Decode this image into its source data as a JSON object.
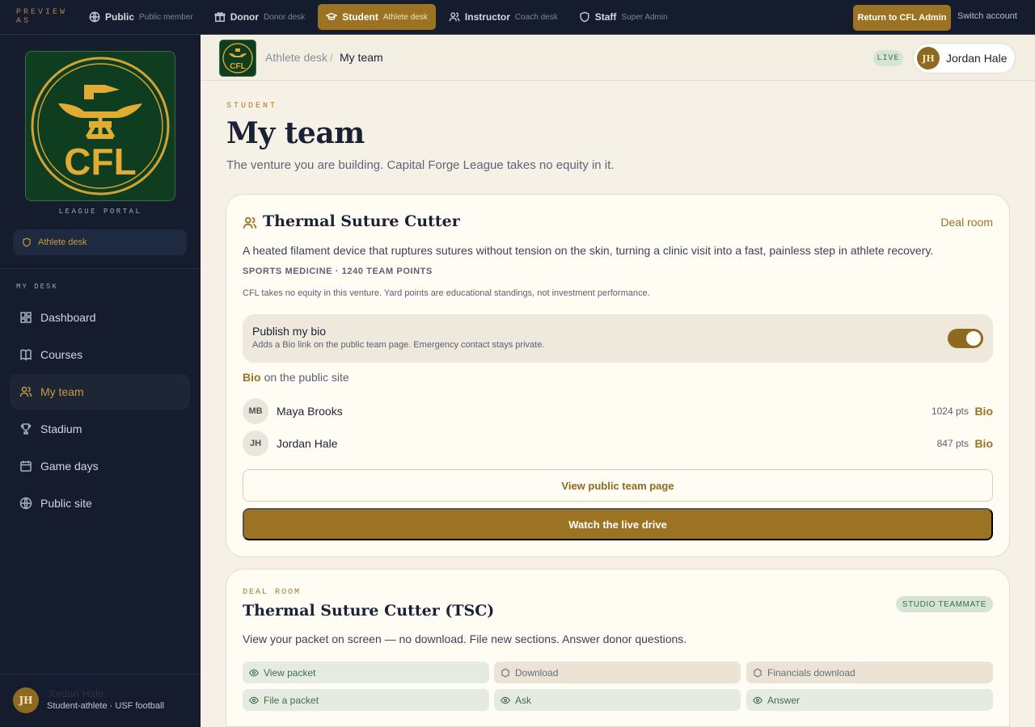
{
  "preview_bar": {
    "label": "PREVIEW AS",
    "roles": [
      {
        "name": "Public",
        "sub": "Public member",
        "icon": "globe-icon",
        "active": false
      },
      {
        "name": "Donor",
        "sub": "Donor desk",
        "icon": "gift-icon",
        "active": false
      },
      {
        "name": "Student",
        "sub": "Athlete desk",
        "icon": "graduation-cap-icon",
        "active": true
      },
      {
        "name": "Instructor",
        "sub": "Coach desk",
        "icon": "users-icon",
        "active": false
      },
      {
        "name": "Staff",
        "sub": "Super Admin",
        "icon": "shield-icon",
        "active": false
      }
    ],
    "return_label": "Return to CFL Admin",
    "switch_label": "Switch account"
  },
  "sidebar": {
    "logo_text": "CFL",
    "portal_label": "LEAGUE PORTAL",
    "desk_pill": "Athlete desk",
    "section_label": "MY DESK",
    "items": [
      {
        "label": "Dashboard",
        "icon": "dashboard-icon",
        "active": false
      },
      {
        "label": "Courses",
        "icon": "book-icon",
        "active": false
      },
      {
        "label": "My team",
        "icon": "users-icon",
        "active": true
      },
      {
        "label": "Stadium",
        "icon": "trophy-icon",
        "active": false
      },
      {
        "label": "Game days",
        "icon": "calendar-icon",
        "active": false
      },
      {
        "label": "Public site",
        "icon": "globe-icon",
        "active": false
      }
    ],
    "user": {
      "initials": "JH",
      "name": "Jordan Hale",
      "role": "Student-athlete · USF football"
    }
  },
  "header": {
    "logo_text": "CFL",
    "breadcrumb": [
      "Athlete desk",
      "My team"
    ],
    "separator": "/",
    "live_label": "LIVE",
    "user_initials": "JH",
    "user_name": "Jordan Hale"
  },
  "page": {
    "eyebrow": "STUDENT",
    "title": "My team",
    "subtitle": "The venture you are building. Capital Forge League takes no equity in it."
  },
  "team_card": {
    "name": "Thermal Suture Cutter",
    "deal_room_link": "Deal room",
    "description": "A heated filament device that ruptures sutures without tension on the skin, turning a clinic visit into a fast, painless step in athlete recovery.",
    "meta": "SPORTS MEDICINE · 1240 TEAM POINTS",
    "note": "CFL takes no equity in this venture. Yard points are educational standings, not investment performance.",
    "bio_toggle": {
      "title": "Publish my bio",
      "description": "Adds a Bio link on the public team page. Emergency contact stays private.",
      "on": true
    },
    "bio_line_bold": "Bio",
    "bio_line_rest": "on the public site",
    "members": [
      {
        "initials": "MB",
        "name": "Maya Brooks",
        "points": "1024 pts",
        "bio_label": "Bio"
      },
      {
        "initials": "JH",
        "name": "Jordan Hale",
        "points": "847 pts",
        "bio_label": "Bio"
      }
    ],
    "view_public_label": "View public team page",
    "watch_live_label": "Watch the live drive"
  },
  "deal_room": {
    "eyebrow": "DEAL ROOM",
    "title": "Thermal Suture Cutter (TSC)",
    "badge": "STUDIO TEAMMATE",
    "description": "View your packet on screen — no download. File new sections. Answer donor questions.",
    "permissions": [
      {
        "label": "View packet",
        "granted": true,
        "icon": "eye-icon"
      },
      {
        "label": "Download",
        "granted": false,
        "icon": "hexagon-icon"
      },
      {
        "label": "Financials download",
        "granted": false,
        "icon": "hexagon-icon"
      },
      {
        "label": "File a packet",
        "granted": true,
        "icon": "eye-icon"
      },
      {
        "label": "Ask",
        "granted": true,
        "icon": "eye-icon"
      },
      {
        "label": "Answer",
        "granted": true,
        "icon": "eye-icon"
      }
    ]
  },
  "colors": {
    "gold": "#9c7322",
    "navy": "#141c2e",
    "cream": "#fffcf3",
    "green_badge": "#d6e4d3"
  }
}
